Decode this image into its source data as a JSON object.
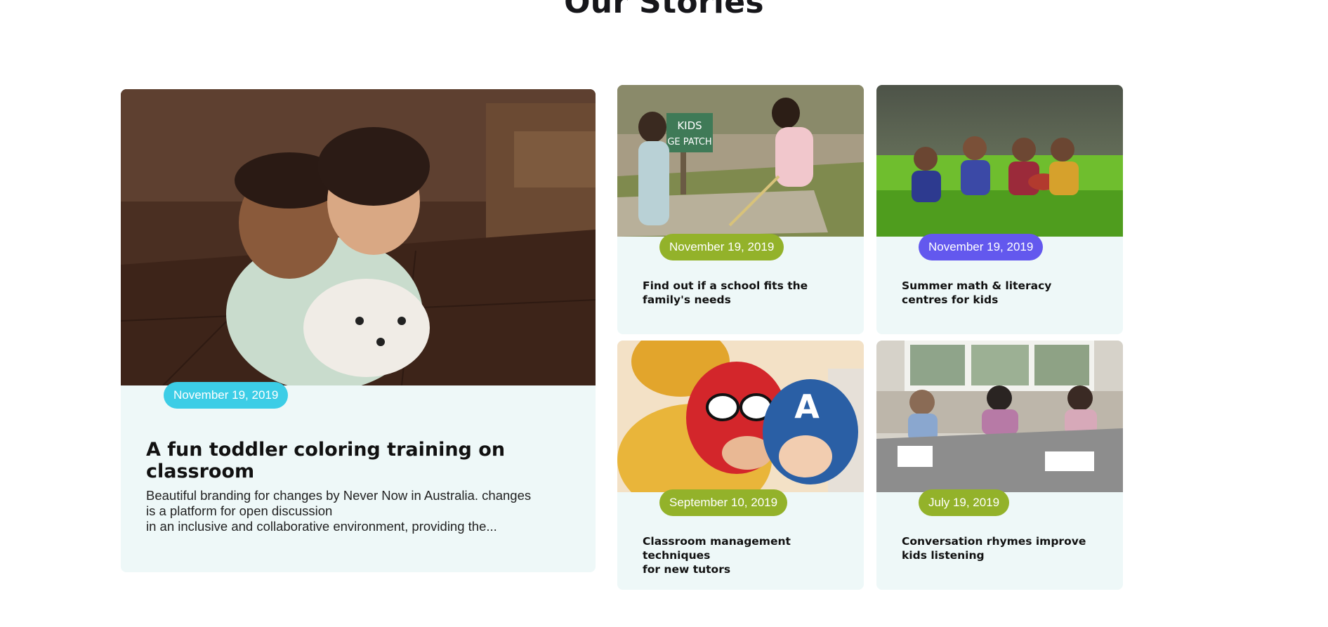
{
  "section": {
    "title": "Our Stories"
  },
  "featured": {
    "date": "November 19, 2019",
    "badge_color": "#3ccde6",
    "title": "A fun toddler coloring training on classroom",
    "excerpt_lines": [
      "Beautiful branding for changes by Never Now in Australia. changes",
      "is a platform for open discussion",
      "in an inclusive and collaborative environment, providing the..."
    ]
  },
  "stories": [
    {
      "date": "November 19, 2019",
      "badge_color": "#93b22a",
      "title_lines": [
        "Find out if a school fits the",
        "family's needs"
      ],
      "sign_text": [
        "KIDS",
        "GE PATCH"
      ]
    },
    {
      "date": "November 19, 2019",
      "badge_color": "#6358ee",
      "title_lines": [
        "Summer math & literacy",
        "centres for kids"
      ]
    },
    {
      "date": "September 10, 2019",
      "badge_color": "#93b22a",
      "title_lines": [
        "Classroom management techniques",
        "for new tutors"
      ],
      "mask_letter": "A"
    },
    {
      "date": "July 19, 2019",
      "badge_color": "#93b22a",
      "title_lines": [
        "Conversation rhymes improve",
        "kids listening"
      ]
    }
  ],
  "colors": {
    "card_bg": "#eef8f8",
    "heading": "#16161a"
  }
}
